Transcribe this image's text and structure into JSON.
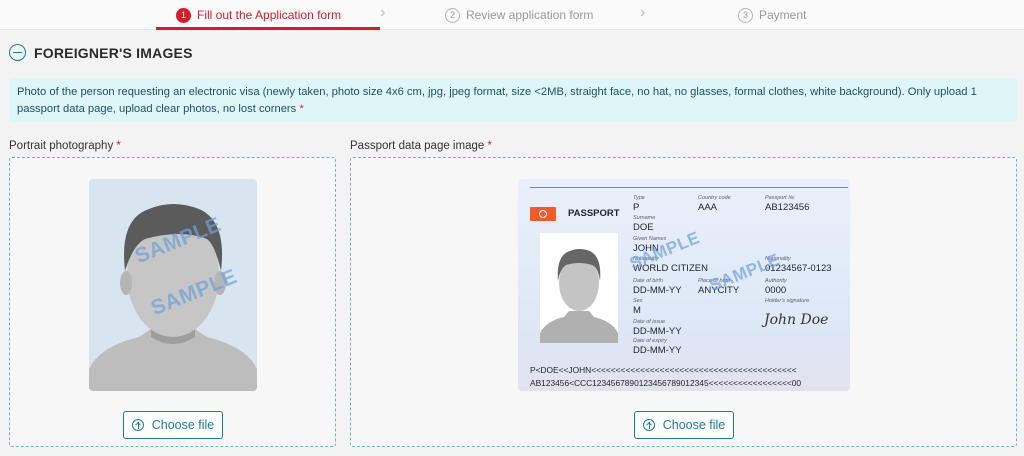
{
  "stepper": {
    "steps": [
      {
        "num": "1",
        "label": "Fill out the Application form"
      },
      {
        "num": "2",
        "label": "Review application form"
      },
      {
        "num": "3",
        "label": "Payment"
      }
    ]
  },
  "section": {
    "title": "FOREIGNER'S IMAGES",
    "info_text": "Photo of the person requesting an electronic visa (newly taken, photo size 4x6 cm, jpg, jpeg format, size <2MB, straight face, no hat, no glasses, formal clothes, white background). Only upload 1 passport data page, upload clear photos, no lost corners",
    "required_mark": "*"
  },
  "portrait": {
    "label": "Portrait photography",
    "watermark": "SAMPLE",
    "button_label": "Choose file"
  },
  "passport": {
    "label": "Passport data page image",
    "button_label": "Choose file",
    "watermark": "SAMPLE",
    "heading": "PASSPORT",
    "fields": {
      "type_label": "Type",
      "type": "P",
      "country_label": "Country code",
      "country": "AAA",
      "number_label": "Passport №",
      "number": "AB123456",
      "surname_label": "Surname",
      "surname": "DOE",
      "given_label": "Given Names",
      "given": "JOHN",
      "nationality_label": "Nationality",
      "nationality": "WORLD CITIZEN",
      "personal_label": "Nationality",
      "personal": "01234567-0123",
      "dob_label": "Date of birth",
      "dob": "DD-MM-YY",
      "pob_label": "Place of birth",
      "pob": "ANYCITY",
      "authority_label": "Authority",
      "authority": "0000",
      "sex_label": "Sex",
      "sex": "M",
      "signature_label": "Holder's signature",
      "signature": "John Doe",
      "issue_label": "Date of issue",
      "issue": "DD-MM-YY",
      "expiry_label": "Date of expiry",
      "expiry": "DD-MM-YY"
    },
    "mrz1": "P<DOE<<JOHN<<<<<<<<<<<<<<<<<<<<<<<<<<<<<<<<<<<<<<<<<<",
    "mrz2": "AB123456<CCC1234567890123456789012345<<<<<<<<<<<<<<<<<00"
  },
  "colors": {
    "accent": "#d11d2a",
    "teal": "#1a7f94",
    "info_bg": "#dff6f8"
  }
}
